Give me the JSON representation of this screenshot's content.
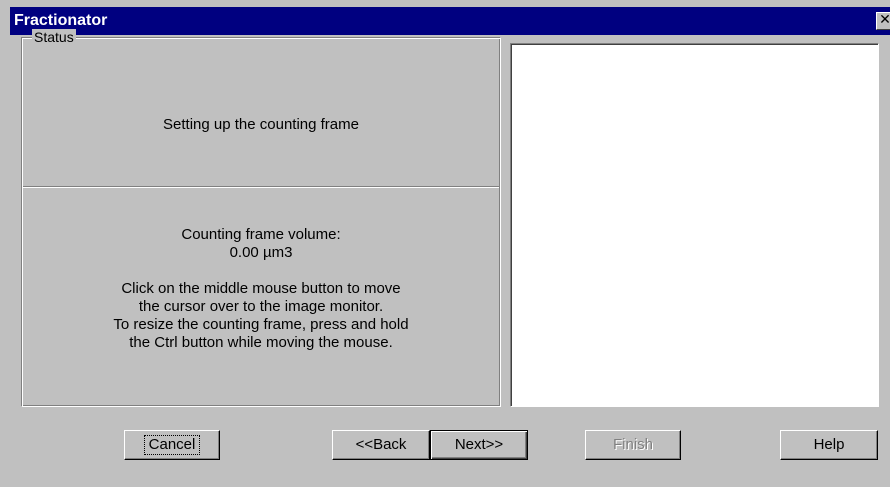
{
  "window": {
    "title": "Fractionator",
    "close_glyph": "✕"
  },
  "status_group": {
    "legend": "Status",
    "status_text": "Setting up the counting frame",
    "volume_label": "Counting frame volume:",
    "volume_value": "0.00 µm3",
    "instructions": [
      "Click on the middle mouse button to move",
      "the cursor over to the image monitor.",
      "To resize the counting frame, press and hold",
      "the Ctrl button while moving the mouse."
    ]
  },
  "buttons": {
    "cancel": "Cancel",
    "back": "<<Back",
    "next": "Next>>",
    "finish": "Finish",
    "help": "Help"
  },
  "colors": {
    "titlebar": "#000080",
    "face": "#c0c0c0",
    "panel": "#ffffff"
  }
}
